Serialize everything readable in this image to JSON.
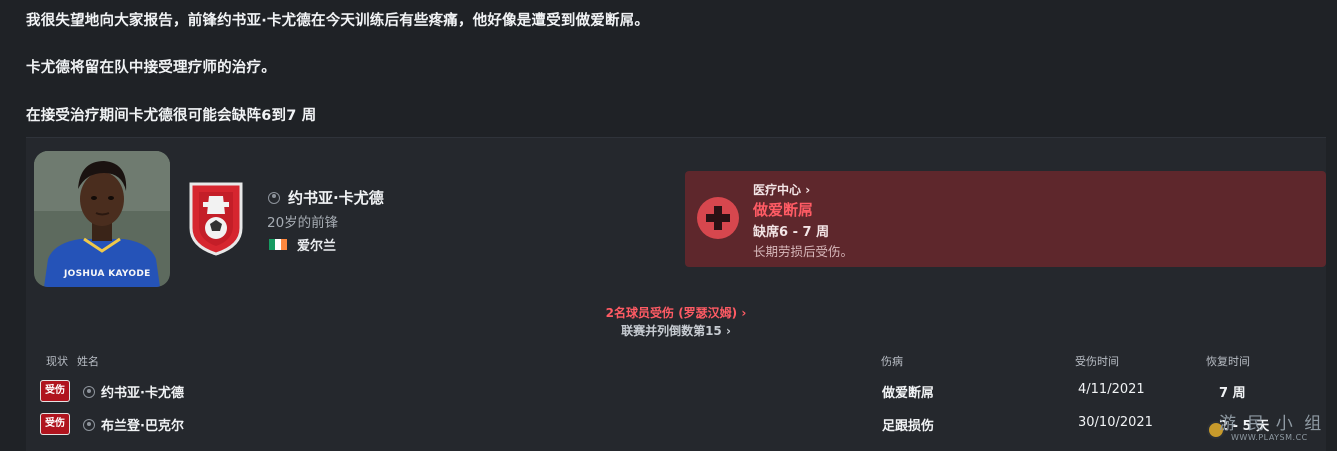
{
  "message": {
    "line1": "我很失望地向大家报告，前锋约书亚·卡尤德在今天训练后有些疼痛，他好像是遭受到做爱断屌。",
    "line2": "卡尤德将留在队中接受理疗师的治疗。",
    "line3": "在接受治疗期间卡尤德很可能会缺阵6到7 周"
  },
  "player": {
    "name": "约书亚·卡尤德",
    "description": "20岁的前锋",
    "nationality": "爱尔兰",
    "shirt_name": "JOSHUA KAYODE",
    "flag_colors": [
      "#169b62",
      "#ffffff",
      "#ff883e"
    ]
  },
  "medical": {
    "title": "医疗中心",
    "injury": "做爱断屌",
    "absence": "缺席6 - 7 周",
    "note": "长期劳损后受伤。"
  },
  "summary": {
    "injured": "2名球员受伤 (罗瑟汉姆)",
    "league": "联赛并列倒数第15"
  },
  "table": {
    "headers": {
      "status": "现状",
      "name": "姓名",
      "injury": "伤病",
      "date": "受伤时间",
      "recovery": "恢复时间"
    },
    "rows": [
      {
        "status": "受伤",
        "name": "约书亚·卡尤德",
        "injury": "做爱断屌",
        "date": "4/11/2021",
        "recovery": "7 周"
      },
      {
        "status": "受伤",
        "name": "布兰登·巴克尔",
        "injury": "足跟损伤",
        "date": "30/10/2021",
        "recovery": "2 - 5 天"
      }
    ]
  },
  "watermark": {
    "big": "游 民 小 组",
    "small": "WWW.PLAYSM.CC"
  },
  "colors": {
    "background": "#1f2226",
    "card": "#25282d",
    "medical_panel": "#5e272c",
    "injury_red": "#ff5b64",
    "badge_red": "#b0141e"
  }
}
